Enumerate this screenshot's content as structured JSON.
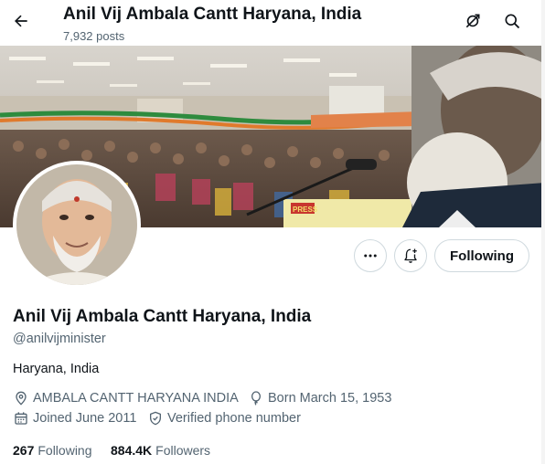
{
  "header": {
    "title": "Anil Vij Ambala Cantt Haryana, India",
    "posts_count": "7,932 posts",
    "back_icon": "arrow-left-icon",
    "icons": [
      "notifications-off-icon",
      "search-icon"
    ]
  },
  "banner": {
    "overlay_text": "PRESS"
  },
  "profile": {
    "name": "Anil Vij Ambala Cantt Haryana, India",
    "handle": "@anilvijminister",
    "bio": "Haryana, India",
    "location": "AMBALA CANTT HARYANA INDIA",
    "born": "Born March 15, 1953",
    "joined": "Joined June 2011",
    "verified": "Verified phone number"
  },
  "actions": {
    "more_icon": "more-icon",
    "notify_icon": "bell-plus-icon",
    "follow_label": "Following"
  },
  "stats": {
    "following_count": "267",
    "following_label": "Following",
    "followers_count": "884.4K",
    "followers_label": "Followers"
  },
  "colors": {
    "text_primary": "#0f1419",
    "text_secondary": "#536471",
    "border": "#cfd9de"
  }
}
